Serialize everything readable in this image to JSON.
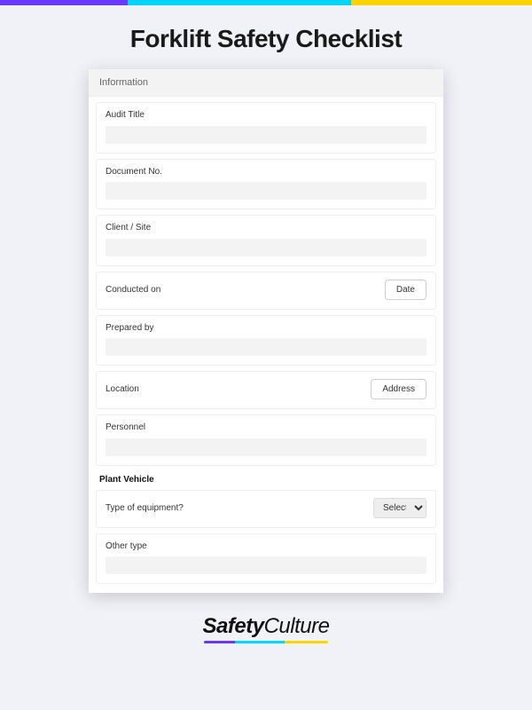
{
  "title": "Forklift Safety Checklist",
  "section": {
    "header": "Information"
  },
  "fields": {
    "audit_title": {
      "label": "Audit Title",
      "value": ""
    },
    "document_no": {
      "label": "Document No.",
      "value": ""
    },
    "client_site": {
      "label": "Client / Site",
      "value": ""
    },
    "conducted_on": {
      "label": "Conducted on",
      "button": "Date"
    },
    "prepared_by": {
      "label": "Prepared by",
      "value": ""
    },
    "location": {
      "label": "Location",
      "button": "Address"
    },
    "personnel": {
      "label": "Personnel",
      "value": ""
    }
  },
  "subsection": {
    "title": "Plant Vehicle"
  },
  "plant": {
    "type_of_equipment": {
      "label": "Type of equipment?",
      "select_placeholder": "Select"
    },
    "other_type": {
      "label": "Other type",
      "value": ""
    }
  },
  "brand": {
    "part1": "Safety",
    "part2": "Culture"
  }
}
